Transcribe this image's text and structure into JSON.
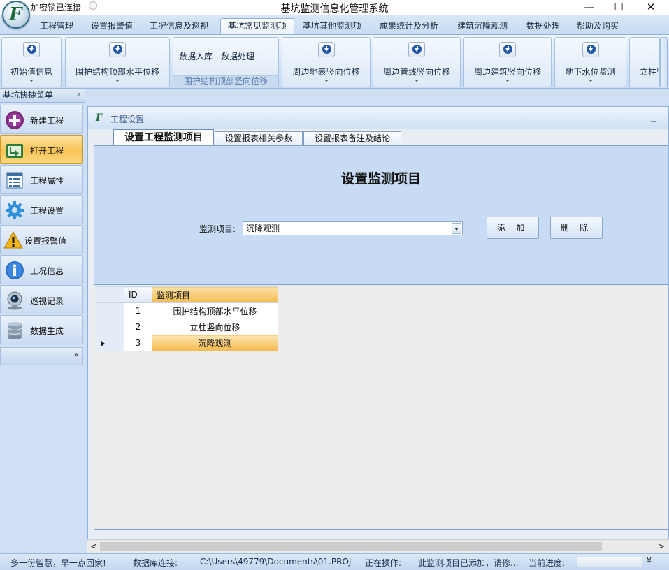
{
  "window": {
    "title": "基坑监测信息化管理系统",
    "qat_text": "加密锁已连接",
    "controls": {
      "minimize": "—",
      "maximize": "☐",
      "close": "✕"
    }
  },
  "logo": {
    "glyph": "F"
  },
  "ribbon_tabs": [
    {
      "label": "工程管理"
    },
    {
      "label": "设置报警值"
    },
    {
      "label": "工况信息及巡视"
    },
    {
      "label": "基坑常见监测项",
      "active": true
    },
    {
      "label": "基坑其他监测项"
    },
    {
      "label": "成果统计及分析"
    },
    {
      "label": "建筑沉降观测"
    },
    {
      "label": "数据处理"
    },
    {
      "label": "帮助及购买"
    }
  ],
  "ribbon": {
    "btn_initial": "初始值信息",
    "btn_horizontal": "围护结构顶部水平位移",
    "small_import": "数据入库",
    "small_process": "数据处理",
    "group_vertical_caption": "围护结构顶部竖向位移",
    "btn_surface": "周边地表竖向位移",
    "btn_pipeline": "周边管线竖向位移",
    "btn_building": "周边建筑竖向位移",
    "btn_groundwater": "地下水位监测",
    "btn_column": "立柱竖"
  },
  "left_panel": {
    "header": "基坑快捷菜单",
    "pin": "ᵖ",
    "items": [
      {
        "label": "新建工程",
        "icon": "plus-circle-icon"
      },
      {
        "label": "打开工程",
        "icon": "open-folder-icon",
        "active": true
      },
      {
        "label": "工程属性",
        "icon": "property-list-icon"
      },
      {
        "label": "工程设置",
        "icon": "gear-icon"
      },
      {
        "label": "设置报警值",
        "icon": "warning-icon"
      },
      {
        "label": "工况信息",
        "icon": "info-icon"
      },
      {
        "label": "巡视记录",
        "icon": "webcam-icon"
      },
      {
        "label": "数据生成",
        "icon": "database-icon"
      }
    ],
    "expand": "»"
  },
  "main_window": {
    "title": "工程设置",
    "minimize": "_",
    "tabs": [
      {
        "label": "设置工程监测项目",
        "active": true
      },
      {
        "label": "设置报表相关参数"
      },
      {
        "label": "设置报表备注及结论"
      }
    ],
    "heading": "设置监测项目",
    "field_label": "监测项目:",
    "field_value": "沉降观测",
    "add_button": "添 加",
    "delete_button": "删 除"
  },
  "grid": {
    "columns": [
      "ID",
      "监测项目"
    ],
    "rows": [
      {
        "id": "1",
        "name": "围护结构顶部水平位移"
      },
      {
        "id": "2",
        "name": "立柱竖向位移"
      },
      {
        "id": "3",
        "name": "沉降观测",
        "selected": true
      }
    ]
  },
  "scrollbar": {
    "left": "<",
    "right": ">"
  },
  "statusbar": {
    "slogan": "多一份智慧，早一点回家!",
    "db_label": "数据库连接:",
    "db_path": "C:\\Users\\49779\\Documents\\01.PROJ",
    "op_label": "正在操作:",
    "op_text": "此监测项目已添加，请修...",
    "progress_label": "当前进度:",
    "progress_value": 0,
    "end_glyph": "¥"
  },
  "colors": {
    "accent_orange": "#f6b94d",
    "ribbon_blue": "#cfe0f5",
    "border_blue": "#8fb0d8"
  }
}
